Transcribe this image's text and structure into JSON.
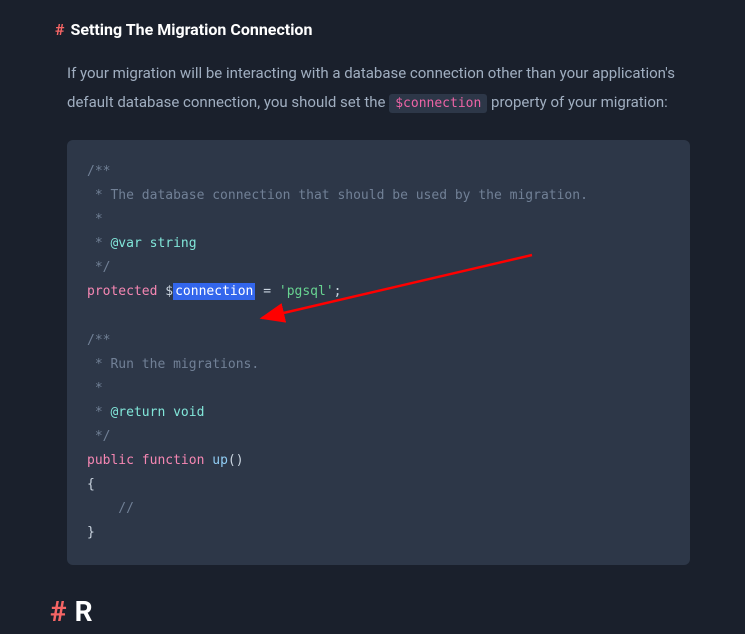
{
  "heading": {
    "hash": "#",
    "text": "Setting The Migration Connection"
  },
  "paragraph": {
    "part1": "If your migration will be interacting with a database connection other than your application's default database connection, you should set the ",
    "code": "$connection",
    "part2": " property of your migration:"
  },
  "code": {
    "l1": "/**",
    "l2": " * The database connection that should be used by the migration.",
    "l3": " *",
    "l4_a": " * ",
    "l4_b": "@var string",
    "l5": " */",
    "l6_protected": "protected",
    "l6_dollar": " $",
    "l6_conn": "connection",
    "l6_eq": " = ",
    "l6_val": "'pgsql'",
    "l6_semi": ";",
    "l8": "/**",
    "l9": " * Run the migrations.",
    "l10": " *",
    "l11_a": " * ",
    "l11_b": "@return void",
    "l12": " */",
    "l13_public": "public",
    "l13_function": " function ",
    "l13_name": "up",
    "l13_paren": "()",
    "l14": "{",
    "l15": "    //",
    "l16": "}"
  },
  "next_heading": {
    "hash": "#",
    "partial": "R"
  },
  "colors": {
    "accent_red": "#f56565",
    "arrow_red": "#ff0000",
    "selection": "#3366ec"
  }
}
